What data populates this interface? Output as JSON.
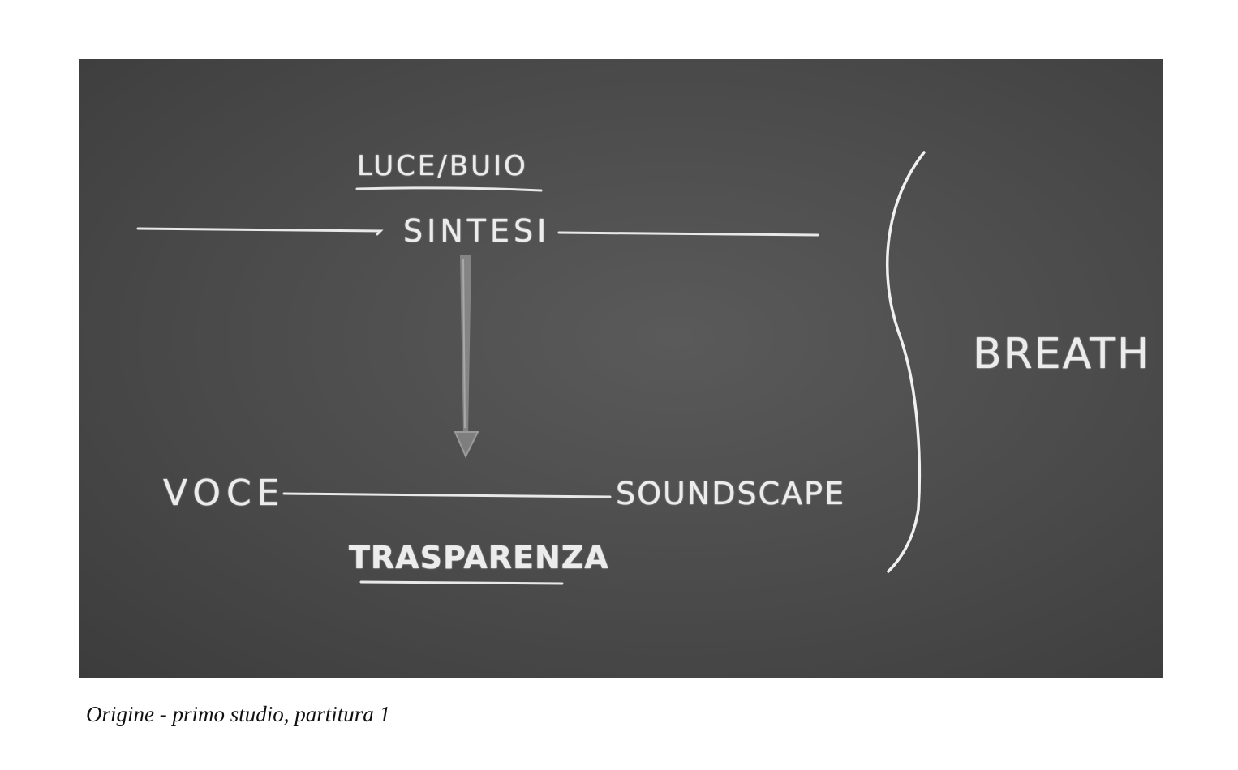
{
  "board": {
    "luce_buio": "LUCE/BUIO",
    "sintesi": "SINTESI",
    "voce": "VOCE",
    "soundscape": "SOUNDSCAPE",
    "trasparenza": "TRASPARENZA",
    "breath": "BREATH"
  },
  "caption": "Origine - primo studio, partitura 1"
}
